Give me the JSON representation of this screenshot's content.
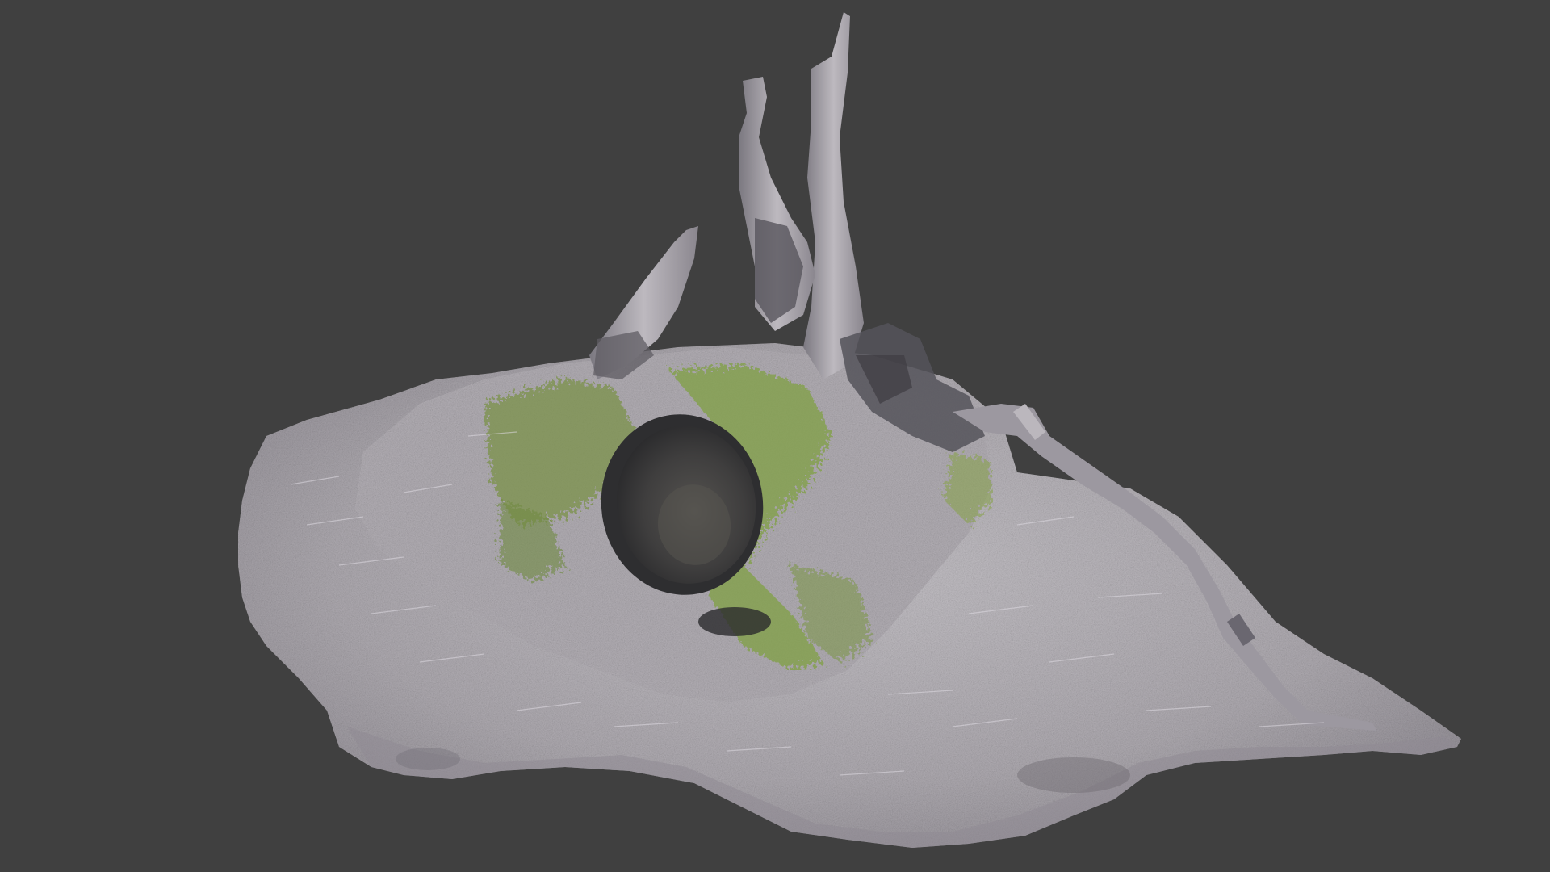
{
  "viewport": {
    "background_color": "#404040"
  },
  "scene": {
    "subject": "scanned-tree-stump-model",
    "colors": {
      "ground": "#b7b3b8",
      "ground_shadow": "#8c8890",
      "grass_highlight": "#d8d6dc",
      "moss": "#7f9a4a",
      "moss_dark": "#566b33",
      "wood": "#a8a4aa",
      "wood_dark": "#6d6a72",
      "cut_face": "#3b3b3d",
      "cut_face_inner": "#4e4d4c"
    }
  }
}
